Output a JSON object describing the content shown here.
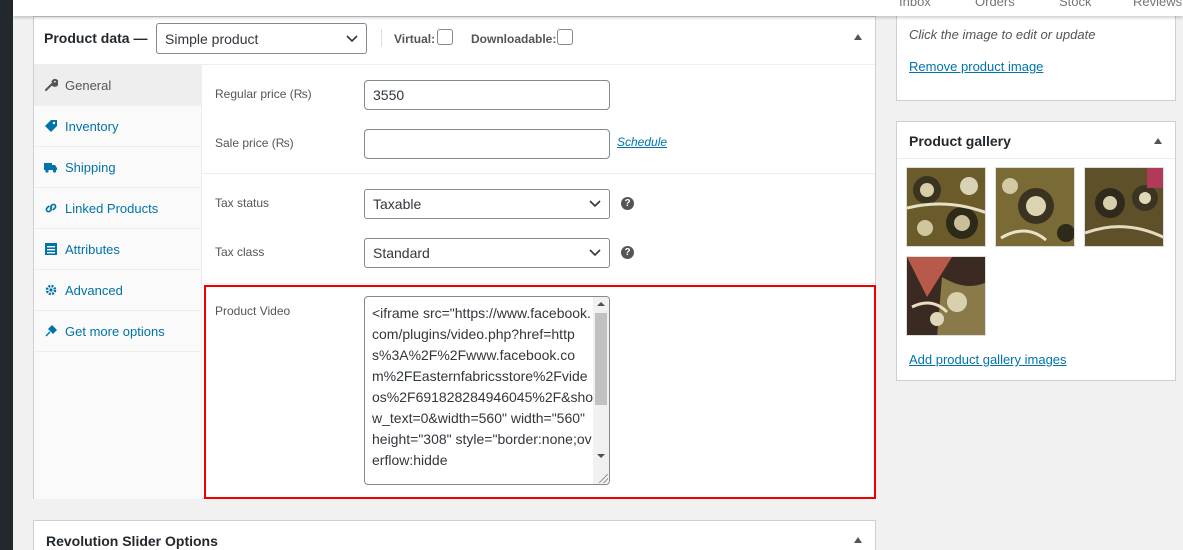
{
  "top_tabs": [
    "Inbox",
    "Orders",
    "Stock",
    "Reviews"
  ],
  "product_data": {
    "title": "Product data —",
    "type_value": "Simple product",
    "virtual_label": "Virtual:",
    "downloadable_label": "Downloadable:"
  },
  "tabs": [
    {
      "label": "General",
      "icon": "wrench-icon",
      "active": true
    },
    {
      "label": "Inventory",
      "icon": "tag-icon"
    },
    {
      "label": "Shipping",
      "icon": "truck-icon"
    },
    {
      "label": "Linked Products",
      "icon": "link-icon"
    },
    {
      "label": "Attributes",
      "icon": "list-icon"
    },
    {
      "label": "Advanced",
      "icon": "gear-icon"
    },
    {
      "label": "Get more options",
      "icon": "plugin-icon"
    }
  ],
  "general": {
    "regular_price_label": "Regular price (₨)",
    "regular_price_value": "3550",
    "sale_price_label": "Sale price (₨)",
    "sale_price_value": "",
    "schedule_link": "Schedule",
    "tax_status_label": "Tax status",
    "tax_status_value": "Taxable",
    "tax_class_label": "Tax class",
    "tax_class_value": "Standard",
    "product_video_label": "Product Video",
    "product_video_value": "<iframe src=\"https://www.facebook.com/plugins/video.php?href=https%3A%2F%2Fwww.facebook.com%2FEasternfabricsstore%2Fvideos%2F691828284946045%2F&show_text=0&width=560\" width=\"560\" height=\"308\" style=\"border:none;overflow:hidde"
  },
  "revolution_slider": {
    "title": "Revolution Slider Options"
  },
  "product_image": {
    "hint": "Click the image to edit or update",
    "remove_link": "Remove product image"
  },
  "gallery": {
    "title": "Product gallery",
    "add_link": "Add product gallery images",
    "image_count": 4
  },
  "colors": {
    "link": "#0073aa",
    "highlight_border": "#e00000",
    "admin_bar": "#23282d"
  }
}
